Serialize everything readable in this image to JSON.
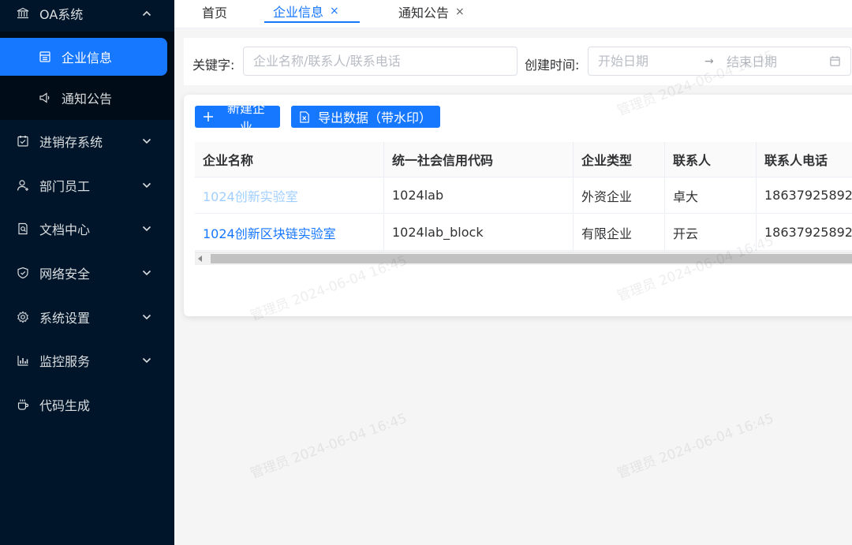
{
  "sidebar": {
    "top": {
      "label": "OA系统",
      "icon": "bank-icon"
    },
    "sub_items": [
      {
        "label": "企业信息",
        "icon": "calendar-icon",
        "active": true
      },
      {
        "label": "通知公告",
        "icon": "sound-icon",
        "active": false
      }
    ],
    "items": [
      {
        "label": "进销存系统",
        "icon": "schedule-icon"
      },
      {
        "label": "部门员工",
        "icon": "user-icon"
      },
      {
        "label": "文档中心",
        "icon": "file-search-icon"
      },
      {
        "label": "网络安全",
        "icon": "shield-icon"
      },
      {
        "label": "系统设置",
        "icon": "gear-icon"
      },
      {
        "label": "监控服务",
        "icon": "bar-chart-icon"
      },
      {
        "label": "代码生成",
        "icon": "coffee-icon"
      }
    ]
  },
  "tabs": [
    {
      "label": "首页",
      "closable": false,
      "active": false
    },
    {
      "label": "企业信息",
      "closable": true,
      "active": true
    },
    {
      "label": "通知公告",
      "closable": true,
      "active": false
    }
  ],
  "tab_close": "×",
  "search": {
    "keyword_label": "关键字:",
    "keyword_placeholder": "企业名称/联系人/联系电话",
    "date_label": "创建时间:",
    "start_placeholder": "开始日期",
    "date_sep": "→",
    "end_placeholder": "结束日期"
  },
  "toolbar": {
    "new_label": "新建企业",
    "export_label": "导出数据（带水印）"
  },
  "table": {
    "headers": [
      "企业名称",
      "统一社会信用代码",
      "企业类型",
      "联系人",
      "联系人电话"
    ],
    "rows": [
      [
        "1024创新实验室",
        "1024lab",
        "外资企业",
        "卓大",
        "18637925892"
      ],
      [
        "1024创新区块链实验室",
        "1024lab_block",
        "有限企业",
        "开云",
        "18637925892"
      ]
    ]
  },
  "watermark": "管理员 2024-06-04 16:45",
  "colors": {
    "sidebar_bg": "#001529",
    "accent": "#1677ff"
  }
}
